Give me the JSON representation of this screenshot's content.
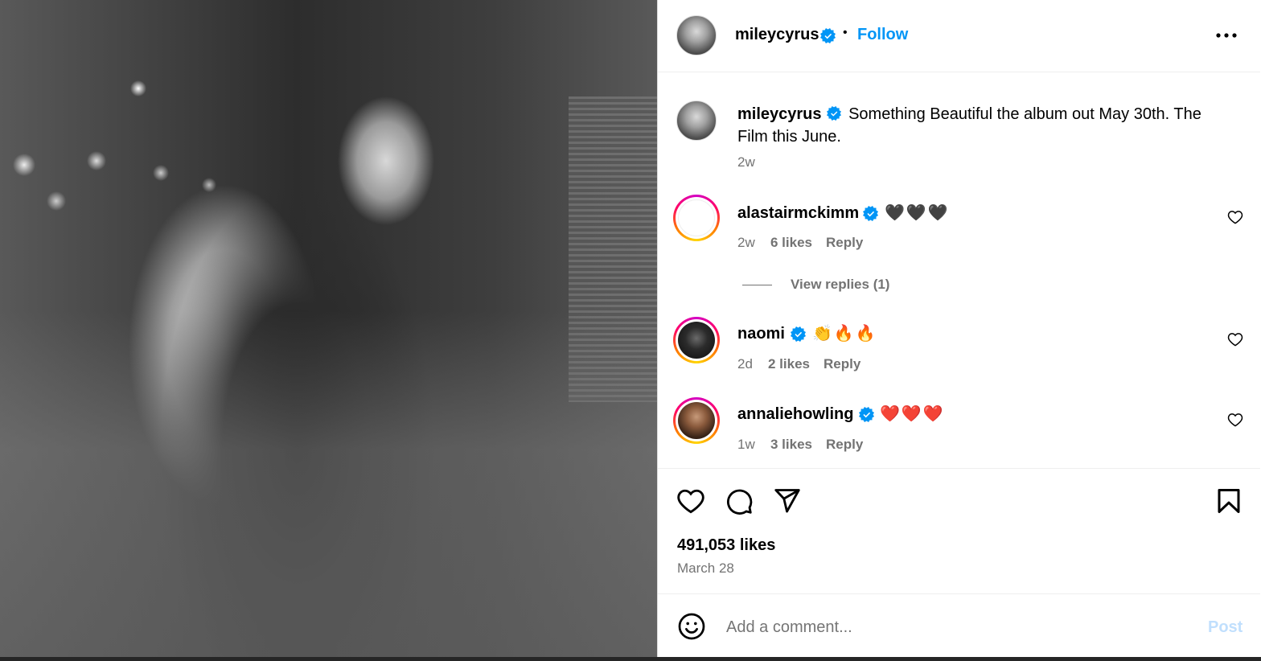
{
  "post": {
    "author": "mileycyrus",
    "follow_label": "Follow",
    "separator": "•",
    "caption": "Something Beautiful the album out May 30th. The Film this June.",
    "caption_age": "2w",
    "likes": "491,053 likes",
    "date": "March 28"
  },
  "comments": [
    {
      "username": "alastairmckimm",
      "text": "🖤🖤🖤",
      "age": "2w",
      "likes": "6 likes",
      "reply": "Reply",
      "view_replies": "View replies (1)"
    },
    {
      "username": "naomi",
      "text": "👏🔥🔥",
      "age": "2d",
      "likes": "2 likes",
      "reply": "Reply"
    },
    {
      "username": "annaliehowling",
      "text": "❤️❤️❤️",
      "age": "1w",
      "likes": "3 likes",
      "reply": "Reply"
    }
  ],
  "composer": {
    "placeholder": "Add a comment...",
    "post_label": "Post"
  },
  "colors": {
    "accent": "#0095f6",
    "verified": "#0095f6",
    "muted": "#737373",
    "post_disabled": "#c0dffd"
  },
  "icons": [
    "more-icon",
    "verified-icon",
    "heart-icon",
    "comment-icon",
    "share-icon",
    "bookmark-icon",
    "emoji-icon"
  ]
}
